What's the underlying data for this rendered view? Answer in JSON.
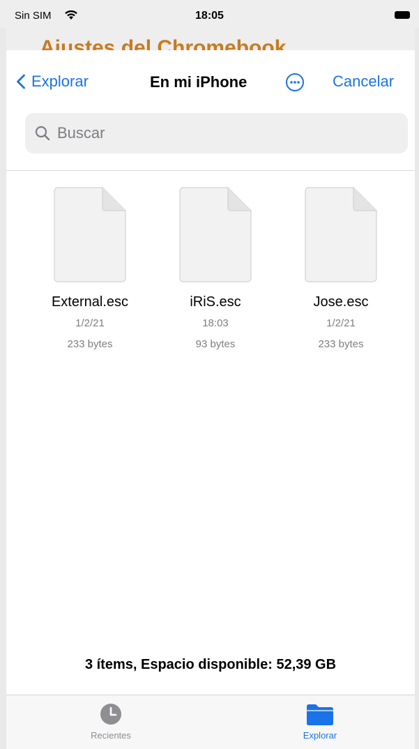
{
  "status_bar": {
    "carrier": "Sin SIM",
    "time": "18:05"
  },
  "background_page": {
    "title": "Ajustes del Chromebook"
  },
  "nav": {
    "back_label": "Explorar",
    "title": "En mi iPhone",
    "cancel_label": "Cancelar"
  },
  "search": {
    "placeholder": "Buscar",
    "value": ""
  },
  "files": [
    {
      "name": "External.esc",
      "date": "1/2/21",
      "size": "233 bytes"
    },
    {
      "name": "iRiS.esc",
      "date": "18:03",
      "size": "93 bytes"
    },
    {
      "name": "Jose.esc",
      "date": "1/2/21",
      "size": "233 bytes"
    }
  ],
  "footer": {
    "info": "3 ítems, Espacio disponible: 52,39 GB"
  },
  "tabs": [
    {
      "label": "Recientes",
      "icon": "clock-icon",
      "active": false
    },
    {
      "label": "Explorar",
      "icon": "folder-icon",
      "active": true
    }
  ],
  "colors": {
    "accent": "#1a73e8",
    "background_title": "#c97a21"
  }
}
